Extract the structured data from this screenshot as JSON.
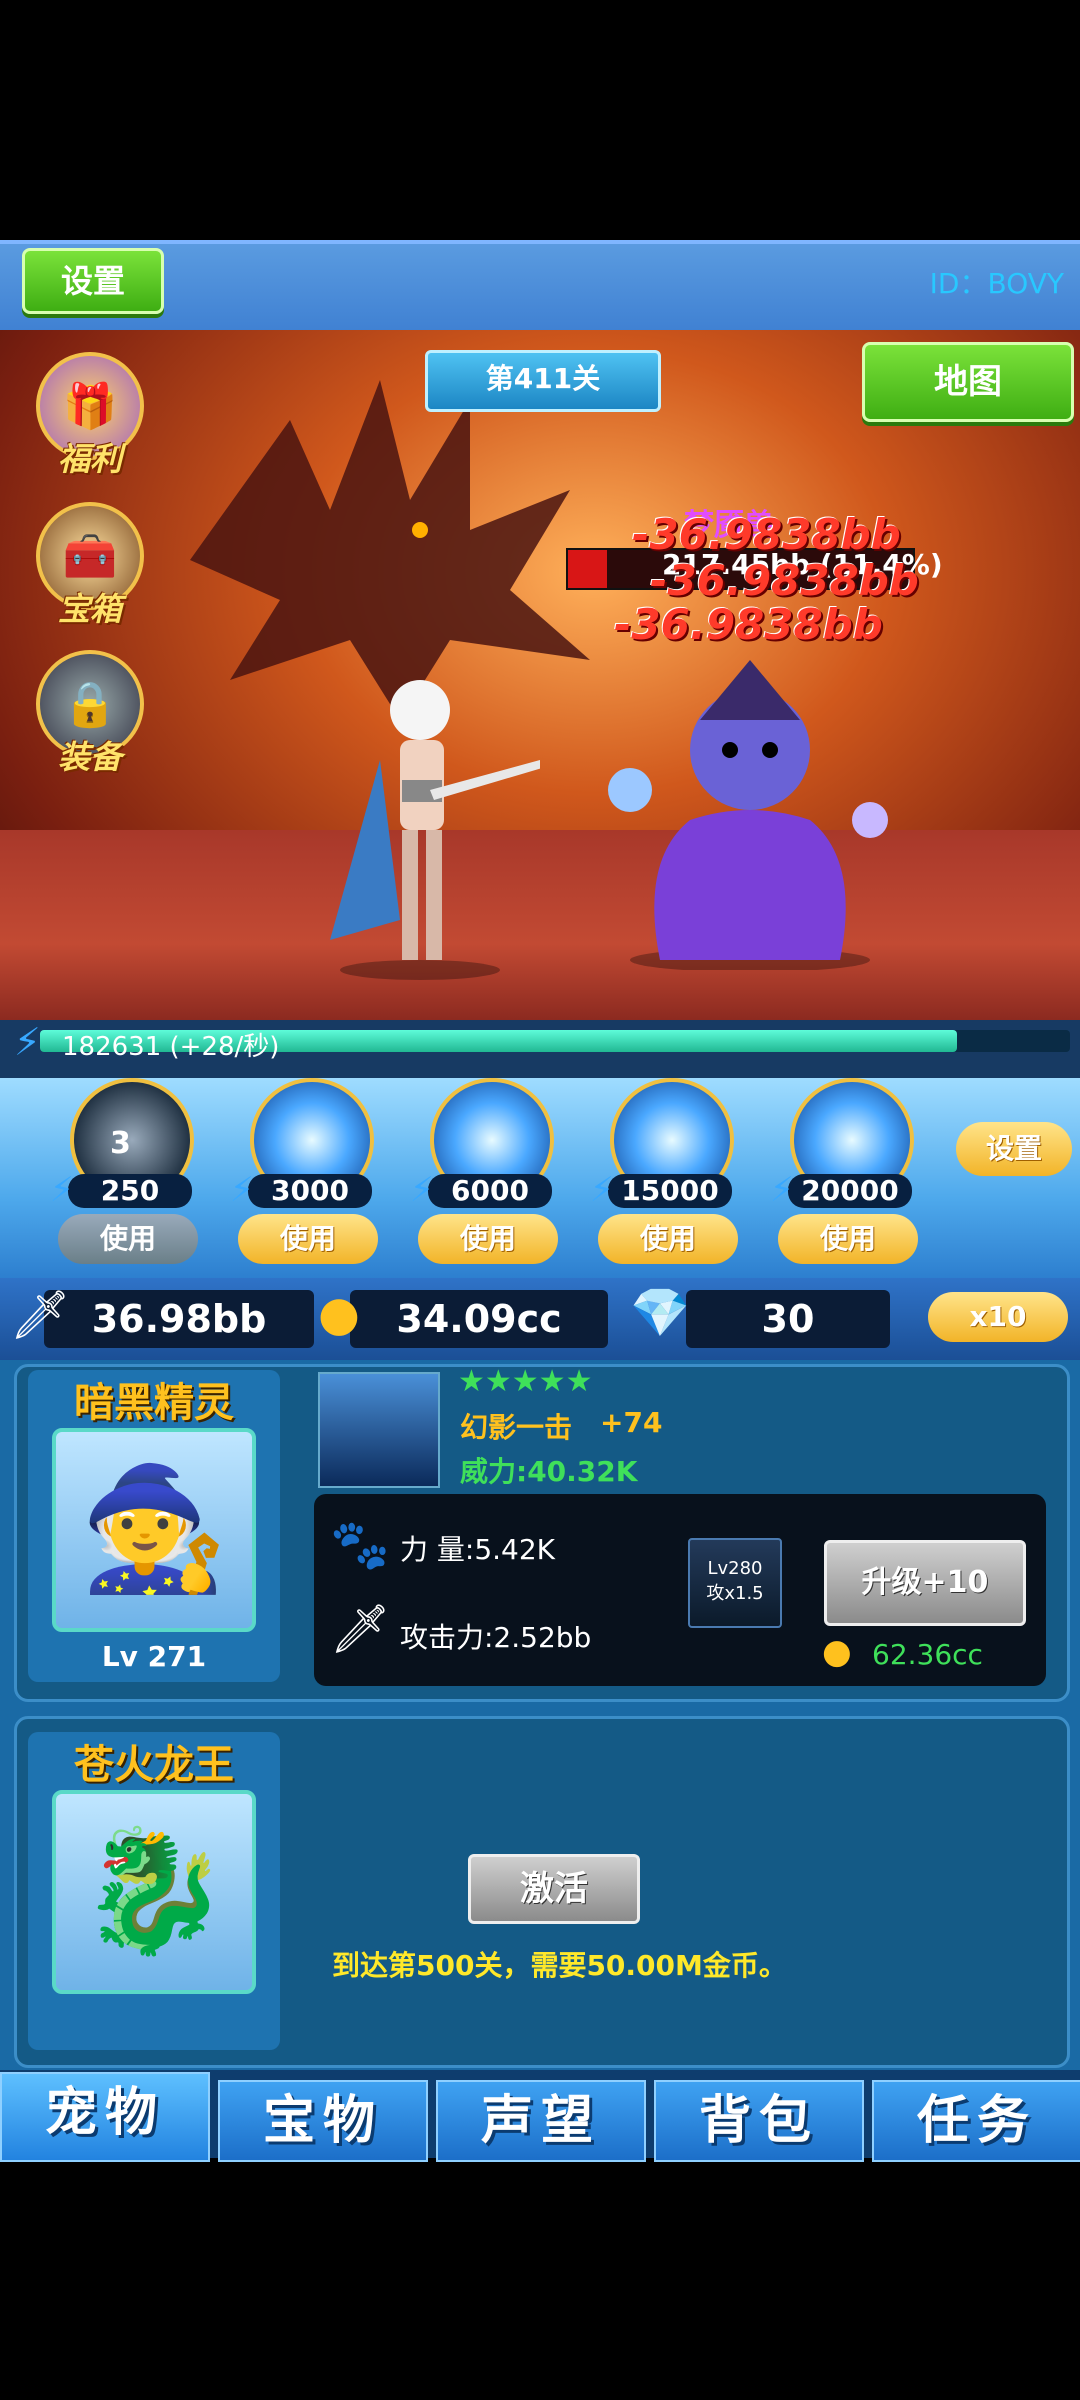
{
  "topbar": {
    "settings_label": "设置",
    "player_id": "ID：BOVY"
  },
  "stage": {
    "label": "第411关"
  },
  "map_label": "地图",
  "side_icons": [
    {
      "label": "福利",
      "icon": "gift-icon"
    },
    {
      "label": "宝箱",
      "icon": "treasure-chest-icon"
    },
    {
      "label": "装备",
      "icon": "locked-equipment-icon"
    }
  ],
  "enemy": {
    "name": "梦魇兽",
    "hp_text": "217.45bb (11.4%)",
    "hp_fraction": 0.114,
    "damage": [
      "-36.9838bb",
      "-36.9838bb",
      "-36.9838bb"
    ]
  },
  "energy": {
    "text": "182631  (+28/秒)",
    "fraction": 0.89
  },
  "skills": [
    {
      "cost": "250",
      "use_label": "使用",
      "count": "3",
      "disabled": true
    },
    {
      "cost": "3000",
      "use_label": "使用",
      "count": "",
      "disabled": false
    },
    {
      "cost": "6000",
      "use_label": "使用",
      "count": "",
      "disabled": false
    },
    {
      "cost": "15000",
      "use_label": "使用",
      "count": "",
      "disabled": false
    },
    {
      "cost": "20000",
      "use_label": "使用",
      "count": "",
      "disabled": false
    }
  ],
  "skill_settings_label": "设置",
  "currency": {
    "attack": "36.98bb",
    "gold": "34.09cc",
    "gems": "30",
    "multiplier_label": "x10"
  },
  "pets": {
    "pet1": {
      "name": "暗黑精灵",
      "level": "Lv 271",
      "skill_name": "幻影一击",
      "skill_bonus": "+74",
      "power": "威力:40.32K",
      "stars": 5,
      "strength": "力  量:5.42K",
      "attack": "攻击力:2.52bb",
      "next_unlock": "Lv280",
      "next_bonus": "攻x1.5",
      "upgrade_label": "升级+10",
      "upgrade_cost": "62.36cc"
    },
    "pet2": {
      "name": "苍火龙王",
      "activate_label": "激活",
      "requirement": "到达第500关，需要50.00M金币。"
    }
  },
  "tabs": [
    "宠物",
    "宝物",
    "声望",
    "背包",
    "任务"
  ],
  "colors": {
    "accent_green": "#5cc61e",
    "gold_text": "#ffc11e",
    "damage_red": "#ff3a2a",
    "panel_blue": "#1a6aa5"
  }
}
